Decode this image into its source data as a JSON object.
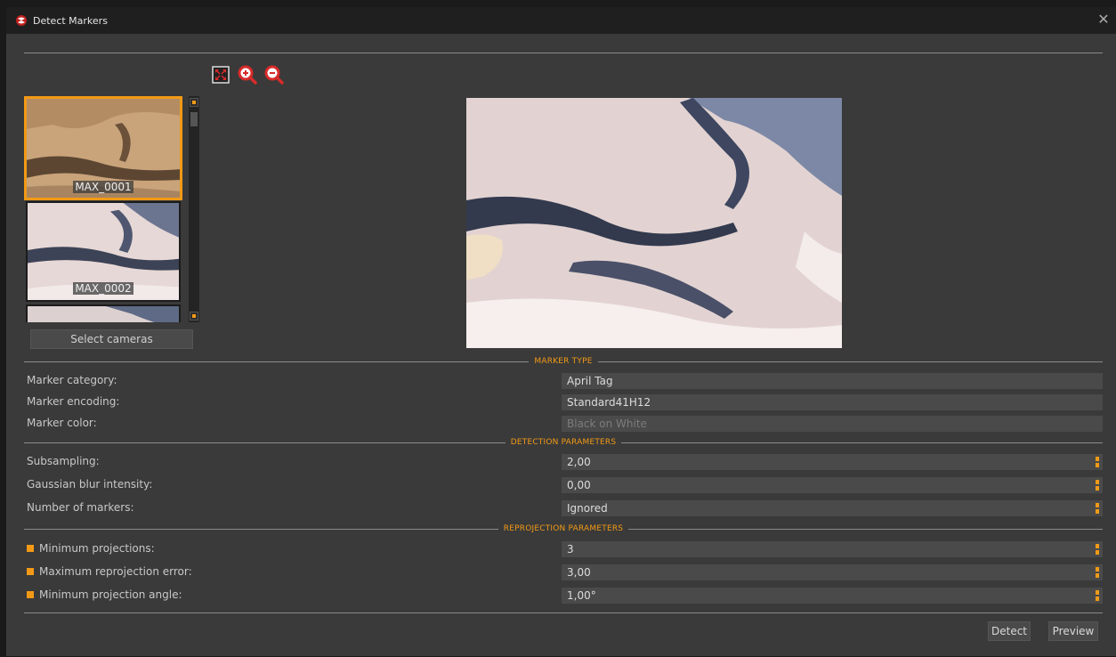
{
  "window": {
    "title": "Detect Markers"
  },
  "thumbnails": [
    {
      "label": "MAX_0001"
    },
    {
      "label": "MAX_0002"
    }
  ],
  "select_cameras_label": "Select cameras",
  "sections": {
    "marker_type": "MARKER TYPE",
    "detection": "DETECTION PARAMETERS",
    "reprojection": "REPROJECTION PARAMETERS"
  },
  "marker_type": {
    "category_label": "Marker category:",
    "category_value": "April Tag",
    "encoding_label": "Marker encoding:",
    "encoding_value": "Standard41H12",
    "color_label": "Marker color:",
    "color_value": "Black on White"
  },
  "detection": {
    "subsampling_label": "Subsampling:",
    "subsampling_value": "2,00",
    "blur_label": "Gaussian blur intensity:",
    "blur_value": "0,00",
    "markers_label": "Number of markers:",
    "markers_value": "Ignored"
  },
  "reprojection": {
    "min_proj_label": "Minimum projections:",
    "min_proj_value": "3",
    "max_err_label": "Maximum reprojection error:",
    "max_err_value": "3,00",
    "min_angle_label": "Minimum projection angle:",
    "min_angle_value": "1,00°"
  },
  "buttons": {
    "detect": "Detect",
    "preview": "Preview"
  },
  "colors": {
    "accent": "#f29a16",
    "background": "#3a3a3a",
    "field": "#4a4a4a",
    "titlebar": "#1f1f1f"
  }
}
